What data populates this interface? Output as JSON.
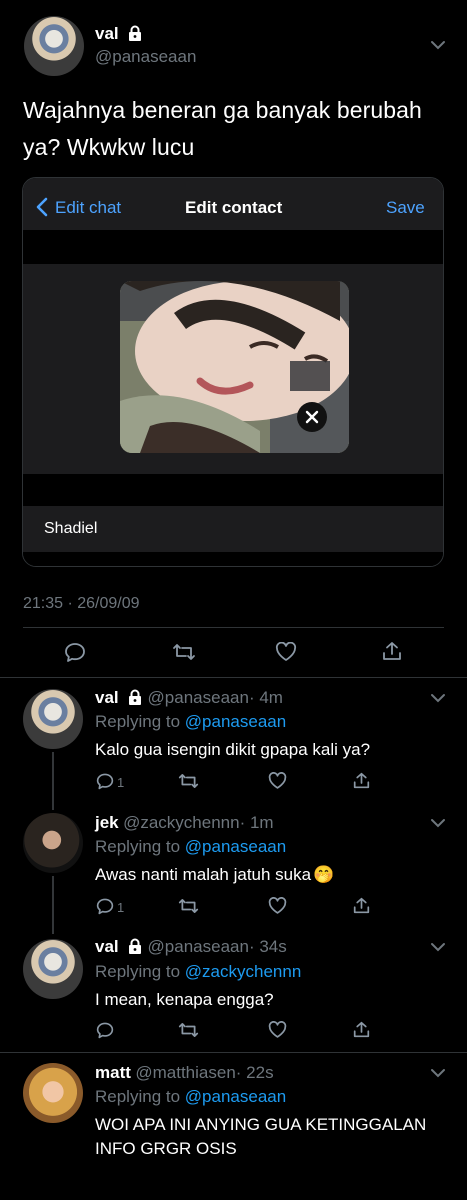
{
  "main_tweet": {
    "name": "val",
    "handle": "@panaseaan",
    "text_line1": "Wajahnya beneran ga banyak berubah",
    "text_line2": "ya? Wkwkw lucu",
    "timestamp": "21:35 · 26/09/09"
  },
  "screenshot_card": {
    "back_label": "Edit chat",
    "title": "Edit contact",
    "save_label": "Save",
    "contact_name": "Shadiel"
  },
  "replies": [
    {
      "name": "val",
      "handle": "@panaseaan",
      "time": "· 4m",
      "replying_prefix": "Replying to",
      "replying_to": "@panaseaan",
      "text": "Kalo gua isengin dikit gpapa kali ya?",
      "reply_count": "1"
    },
    {
      "name": "jek",
      "handle": "@zackychennn",
      "time": "· 1m",
      "replying_prefix": "Replying to",
      "replying_to": "@panaseaan",
      "text": "Awas nanti malah jatuh suka",
      "emoji": "🤭",
      "reply_count": "1"
    },
    {
      "name": "val",
      "handle": "@panaseaan",
      "time": "· 34s",
      "replying_prefix": "Replying to",
      "replying_to": "@zackychennn",
      "text": "I mean, kenapa engga?",
      "reply_count": ""
    },
    {
      "name": "matt",
      "handle": "@matthiasen",
      "time": "· 22s",
      "replying_prefix": "Replying to",
      "replying_to": "@panaseaan",
      "text_line1": "WOI APA INI ANYING GUA KETINGGALAN",
      "text_line2": "INFO GRGR OSIS"
    }
  ],
  "colors": {
    "background": "#000000",
    "muted": "#6e767d",
    "link": "#1d9bf0",
    "ios_blue": "#4da3ff",
    "divider": "#2f3336"
  },
  "icons": [
    "lock-icon",
    "chevron-down-icon",
    "reply-icon",
    "retweet-icon",
    "like-icon",
    "share-icon",
    "back-chevron-icon",
    "close-icon"
  ]
}
